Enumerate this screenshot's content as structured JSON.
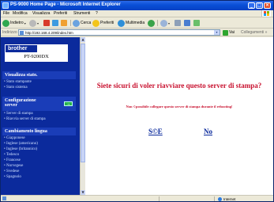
{
  "window": {
    "title": "PS-9000 Home Page - Microsoft Internet Explorer",
    "buttons": {
      "minimize": "_",
      "maximize": "□",
      "close": "×"
    }
  },
  "menu": [
    "File",
    "Modifica",
    "Visualizza",
    "Preferiti",
    "Strumenti",
    "?"
  ],
  "toolbar": {
    "back": "Indietro",
    "search": "Cerca",
    "favorites": "Preferiti",
    "media": "Multimedia",
    "dropdown": "▾"
  },
  "address": {
    "label": "Indirizzo",
    "url": "http://192.168.4.209/index.htm",
    "dropdown": "▾",
    "go": "Vai",
    "links": "Collegamenti »"
  },
  "sidebar": {
    "brand": "brother",
    "model": "PT-9200DX",
    "sections": [
      {
        "title": "Visualizza stato.",
        "items": [
          "Stato stampante",
          "Stato sistema"
        ]
      },
      {
        "title": "Configurazione server",
        "go_button": "→",
        "items": [
          "Server di stampa",
          "Riavvia server di stampa"
        ]
      },
      {
        "title": "Cambiamento lingua",
        "items": [
          "Giapponese",
          "Inglese (americano)",
          "Inglese (britannico)",
          "Tedesco",
          "Francese",
          "Norvegese",
          "Svedese",
          "Spagnolo"
        ]
      }
    ],
    "scroll_up": "▲",
    "scroll_down": "▼"
  },
  "main": {
    "question": "Siete sicuri di voler riavviare questo server di stampa?",
    "warning": "Non ©possibile collegare questo server di stampa durante il rebooting!",
    "yes_label": "S©E",
    "no_label": "No"
  },
  "status": {
    "zone": "Internet"
  }
}
